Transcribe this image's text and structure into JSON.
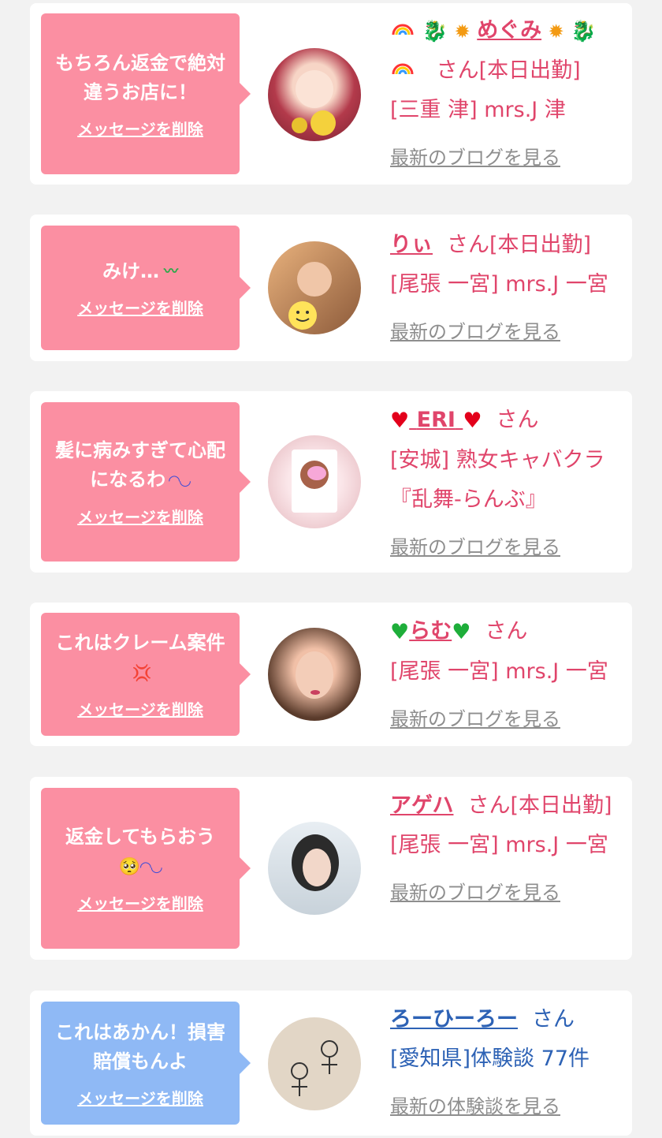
{
  "delete_label": "メッセージを削除",
  "cards": [
    {
      "message": "もちろん返金で絶対違うお店に！",
      "name": "めぐみ",
      "suffix": "さん[本日出勤]",
      "shop": "[三重 津] mrs.J 津",
      "link": "最新のブログを見る"
    },
    {
      "message": "みけ…",
      "name": "りぃ",
      "suffix": "さん[本日出勤]",
      "shop": "[尾張 一宮] mrs.J 一宮",
      "link": "最新のブログを見る"
    },
    {
      "message": "髪に病みすぎて心配になるわ",
      "name": "ERI",
      "suffix": "さん",
      "shop": "[安城] 熟女キャバクラ『乱舞-らんぶ』",
      "link": "最新のブログを見る"
    },
    {
      "message": "これはクレーム案件",
      "name": "らむ",
      "suffix": "さん",
      "shop": "[尾張 一宮] mrs.J 一宮",
      "link": "最新のブログを見る"
    },
    {
      "message": "返金してもらおう",
      "name": "アゲハ",
      "suffix": "さん[本日出勤]",
      "shop": "[尾張 一宮] mrs.J 一宮",
      "link": "最新のブログを見る"
    },
    {
      "message": "これはあかん！損害賠償もんよ",
      "name": "ろーひーろー",
      "suffix": "さん",
      "shop": "[愛知県]体験談 77件",
      "link": "最新の体験談を見る"
    }
  ],
  "colors": {
    "pink": "#fb8fa2",
    "blue": "#8fb9f5",
    "name_pink": "#e0456b",
    "name_blue": "#2d62b5"
  }
}
